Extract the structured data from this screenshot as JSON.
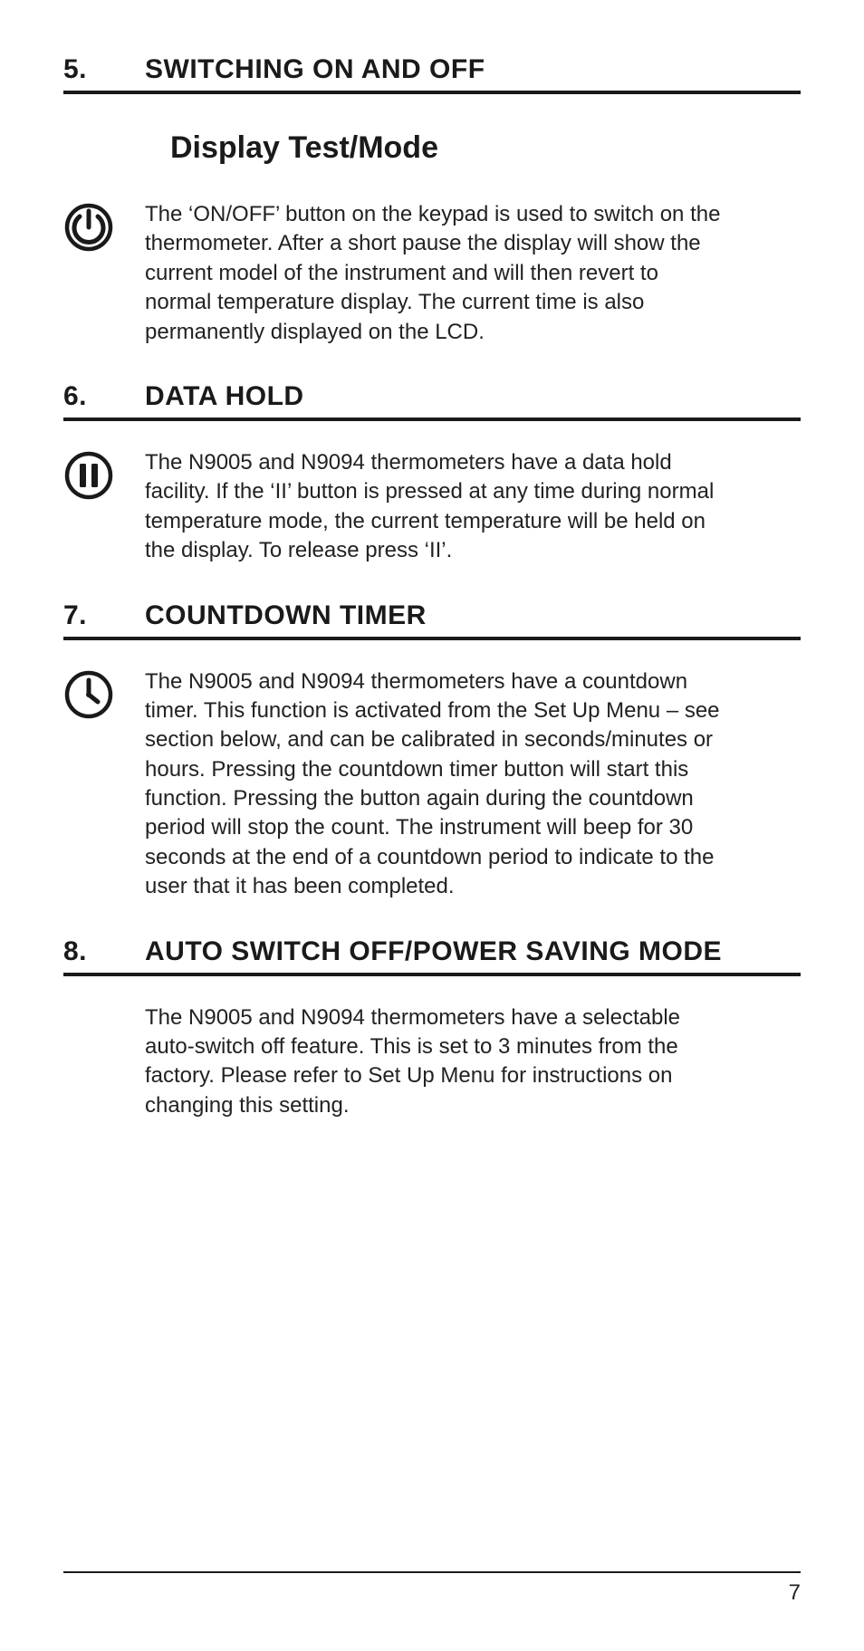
{
  "page_number": "7",
  "sections": {
    "s5": {
      "number": "5.",
      "title": "SWITCHING ON AND OFF",
      "sub": "Display Test/Mode",
      "body": "The ‘ON/OFF’ button on the keypad is used to switch on the thermometer. After a short pause the display will show the current model of the instrument and will then revert to normal temperature display. The current time is also permanently displayed on the LCD."
    },
    "s6": {
      "number": "6.",
      "title": "DATA HOLD",
      "body": "The N9005 and N9094 thermometers have a data hold facility. If the ‘II’ button is pressed at any time during normal temperature mode, the current temperature will be held on the display. To release press ‘II’."
    },
    "s7": {
      "number": "7.",
      "title": "COUNTDOWN TIMER",
      "body": "The N9005 and N9094 thermometers have a countdown timer. This function is activated from the Set Up Menu – see section below, and can be calibrated in seconds/minutes or hours. Pressing the countdown timer button will start this function. Pressing the button again during the countdown period will stop the count. The instrument will beep for 30 seconds at the end of a countdown period to indicate to the user that it has been completed."
    },
    "s8": {
      "number": "8.",
      "title": "AUTO SWITCH OFF/POWER SAVING MODE",
      "body": "The N9005 and N9094 thermometers have a selectable auto-switch off feature. This is set to 3 minutes from the factory. Please refer to Set Up Menu for instructions on changing this setting."
    }
  }
}
